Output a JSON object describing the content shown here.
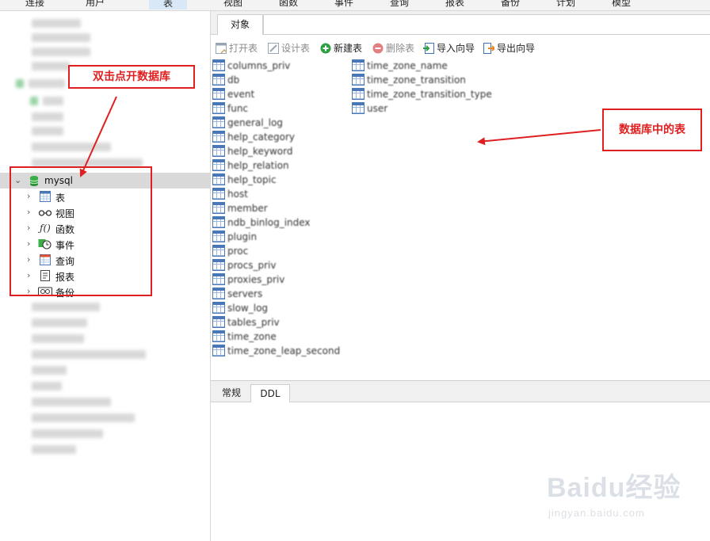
{
  "top_menu": {
    "items": [
      "连接",
      "用户",
      "表",
      "视图",
      "函数",
      "事件",
      "查询",
      "报表",
      "备份",
      "计划",
      "模型"
    ],
    "active_index": 2
  },
  "object_tab": {
    "label": "对象"
  },
  "toolbar": {
    "open": "打开表",
    "design": "设计表",
    "new": "新建表",
    "delete": "删除表",
    "import": "导入向导",
    "export": "导出向导"
  },
  "tree": {
    "db_name": "mysql",
    "children": [
      "表",
      "视图",
      "函数",
      "事件",
      "查询",
      "报表",
      "备份"
    ]
  },
  "tables": {
    "col1": [
      "columns_priv",
      "db",
      "event",
      "func",
      "general_log",
      "help_category",
      "help_keyword",
      "help_relation",
      "help_topic",
      "host",
      "member",
      "ndb_binlog_index",
      "plugin",
      "proc",
      "procs_priv",
      "proxies_priv",
      "servers",
      "slow_log",
      "tables_priv",
      "time_zone",
      "time_zone_leap_second"
    ],
    "col2": [
      "time_zone_name",
      "time_zone_transition",
      "time_zone_transition_type",
      "user"
    ]
  },
  "bottom_tabs": [
    "常规",
    "DDL"
  ],
  "annotations": {
    "double_click": "双击点开数据库",
    "tables_in_db": "数据库中的表"
  },
  "watermark": {
    "brand": "Baidu经验",
    "url": "jingyan.baidu.com"
  },
  "colors": {
    "annotation_red": "#e02020",
    "selected_row": "#d9d9d9",
    "table_icon_blue": "#4a78b6"
  }
}
